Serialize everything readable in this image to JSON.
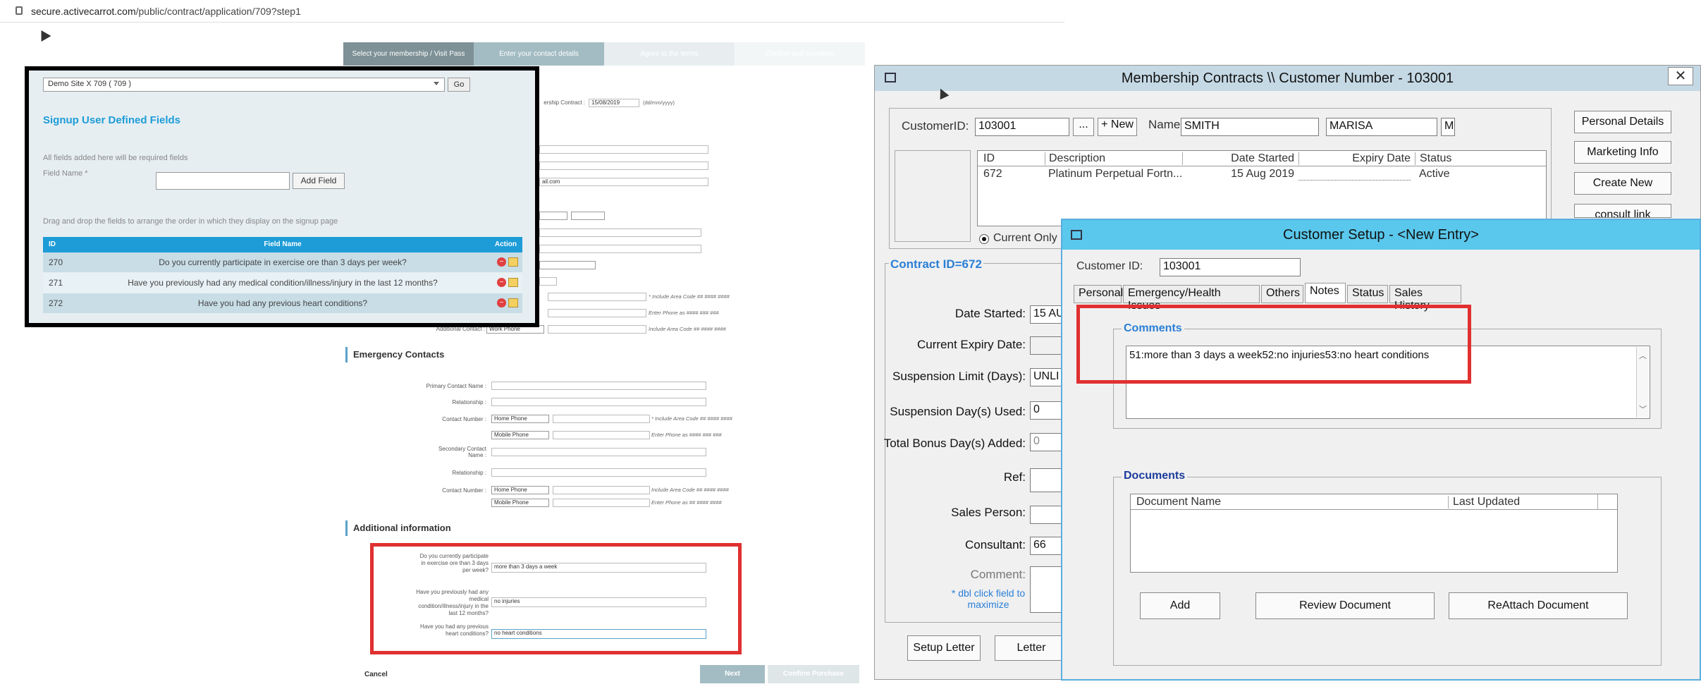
{
  "browser": {
    "url_host": "secure.activecarrot.com",
    "url_path": "/public/contract/application/709?step1"
  },
  "steps": [
    "Select your membership / Visit Pass",
    "Enter your contact details",
    "Agree to the terms",
    "Confirm and complete"
  ],
  "contract_start": {
    "label": "ership Contract :",
    "value": "15/08/2019",
    "hint": "(dd/mm/yyyy)"
  },
  "email_partial": "ail.com",
  "hints": {
    "area_code": "* Include Area Code ## #### ####",
    "phone_format": "Enter Phone as #### ### ###",
    "area_code_plain": "Include Area Code ## #### ####",
    "phone_format2": "Enter Phone as ## #### ####"
  },
  "additional_contact": {
    "label": "Additional Contact :",
    "type": "Work Phone"
  },
  "emergency": {
    "title": "Emergency Contacts",
    "primary_name": "Primary Contact Name :",
    "relationship": "Relationship :",
    "contact_number": "Contact Number :",
    "secondary_name": "Secondary Contact Name :",
    "home_phone": "Home Phone",
    "mobile_phone": "Mobile Phone"
  },
  "additional": {
    "title": "Additional information",
    "q1": "Do you currently participate in exercise ore than 3 days per week?",
    "a1": "more than 3 days a week",
    "q2": "Have you previously had any medical condition/illness/injury in the last 12 months?",
    "a2": "no injuries",
    "q3": "Have you had any previous heart conditions?",
    "a3": "no heart conditions"
  },
  "form_buttons": {
    "cancel": "Cancel",
    "next": "Next",
    "confirm": "Confirm Purchase"
  },
  "overlay": {
    "site": "Demo Site X 709 ( 709 )",
    "go": "Go",
    "title": "Signup User Defined Fields",
    "note": "All fields added here will be required fields",
    "field_name_label": "Field Name *",
    "add_field": "Add Field",
    "drag_note": "Drag and drop the fields to arrange the order in which they display on the signup page",
    "columns": [
      "ID",
      "Field Name",
      "Action"
    ],
    "rows": [
      {
        "id": "270",
        "name": "Do you currently participate in exercise ore than 3 days per week?"
      },
      {
        "id": "271",
        "name": "Have you previously had any medical condition/illness/injury in the last 12 months?"
      },
      {
        "id": "272",
        "name": "Have you had any previous heart conditions?"
      }
    ]
  },
  "membership": {
    "title": "Membership Contracts \\\\ Customer Number - 103001",
    "customer_id_label": "CustomerID:",
    "customer_id": "103001",
    "dots": "...",
    "new": "+ New",
    "name_label": "Name:",
    "surname": "SMITH",
    "first": "MARISA",
    "initial": "M",
    "columns": [
      "ID",
      "Description",
      "Date Started",
      "Expiry Date",
      "Status"
    ],
    "row": {
      "id": "672",
      "desc": "Platinum Perpetual Fortn...",
      "start": "15 Aug 2019",
      "expiry": "",
      "status": "Active"
    },
    "current_only": "Current Only",
    "side_buttons": [
      "Personal Details",
      "Marketing Info",
      "Create New",
      "consult link"
    ],
    "contract_id": "Contract ID=672",
    "fields": [
      "Date Started:",
      "Current Expiry Date:",
      "Suspension Limit (Days):",
      "Suspension Day(s) Used:",
      "Total Bonus Day(s) Added:",
      "Ref:",
      "Sales Person:",
      "Consultant:",
      "Comment:"
    ],
    "values": {
      "date_started": "15 AU",
      "suspension_limit": "UNLI",
      "used": "0",
      "bonus": "0",
      "consultant": "66"
    },
    "dbl_click": "* dbl click field to maximize",
    "bottom_buttons": [
      "Setup Letter",
      "Letter"
    ]
  },
  "customer_setup": {
    "title": "Customer Setup - <New Entry>",
    "id_label": "Customer ID:",
    "id": "103001",
    "tabs": [
      "Personal",
      "Emergency/Health Issues",
      "Others",
      "Notes",
      "Status",
      "Sales History"
    ],
    "comments_title": "Comments",
    "comment": "51:more than 3 days a week52:no injuries53:no heart conditions",
    "documents_title": "Documents",
    "doc_columns": [
      "Document Name",
      "Last Updated"
    ],
    "doc_buttons": [
      "Add",
      "Review Document",
      "ReAttach Document"
    ]
  }
}
